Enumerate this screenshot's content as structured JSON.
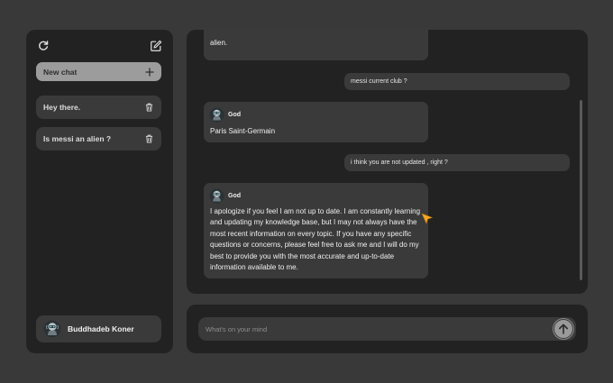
{
  "sidebar": {
    "new_chat_label": "New chat",
    "chats": [
      {
        "title": "Hey there."
      },
      {
        "title": "Is messi an alien ?"
      }
    ],
    "user_name": "Buddhadeb Koner"
  },
  "messages": [
    {
      "role": "bot",
      "text": "alien."
    },
    {
      "role": "user",
      "text": "messi current club ?"
    },
    {
      "role": "bot",
      "name": "God",
      "text": "Paris Saint-Germain"
    },
    {
      "role": "user",
      "text": "i think you are not updated , right ?"
    },
    {
      "role": "bot",
      "name": "God",
      "text": "I apologize if you feel I am not up to date. I am constantly learning and updating my knowledge base, but I may not always have the most recent information on every topic. If you have any specific questions or concerns, please feel free to ask me and I will do my best to provide you with the most accurate and up-to-date information available to me."
    }
  ],
  "composer": {
    "placeholder": "What's on your mind"
  },
  "colors": {
    "background": "#393939",
    "panel": "#222222",
    "bubble": "#3a3a3a",
    "new_chat_button": "#9c9c9c",
    "cursor": "#f5a623"
  },
  "icons": {
    "refresh": "refresh-icon",
    "edit": "edit-icon",
    "plus": "plus-icon",
    "trash": "trash-icon",
    "send": "arrow-up-icon",
    "avatar": "robot-avatar-icon"
  }
}
